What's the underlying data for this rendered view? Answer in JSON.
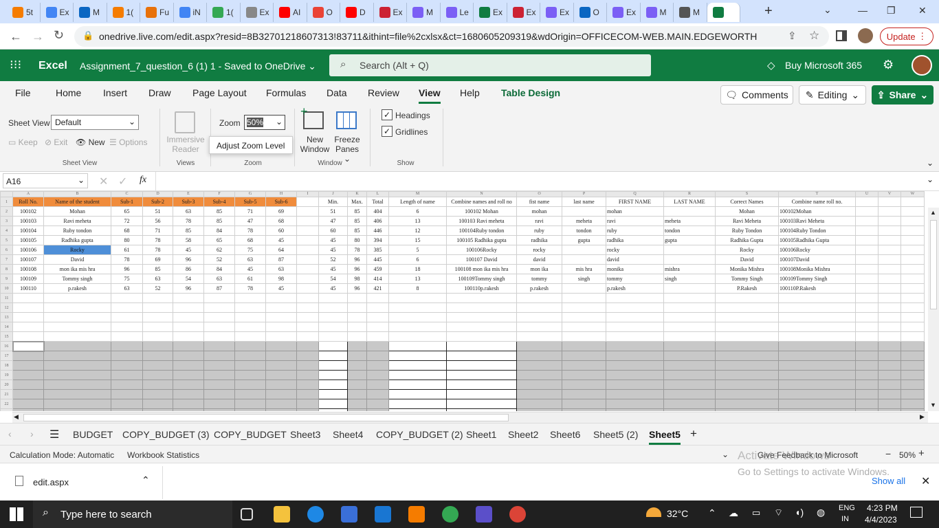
{
  "browser": {
    "tabs": [
      "5t",
      "Ex",
      "M",
      "1(",
      "Fu",
      "iN",
      "1(",
      "Ex",
      "AI",
      "O",
      "D",
      "Ex",
      "M",
      "Le",
      "Ex",
      "Ex",
      "Ex",
      "O",
      "Ex",
      "M",
      "M",
      ""
    ],
    "url": "onedrive.live.com/edit.aspx?resid=8B32701218607313!83711&ithint=file%2cxlsx&ct=1680605209319&wdOrigin=OFFICECOM-WEB.MAIN.EDGEWORTH",
    "update_label": "Update"
  },
  "excel": {
    "app_name": "Excel",
    "doc_title": "Assignment_7_question_6 (1) 1  -  Saved to OneDrive ⌄",
    "search_placeholder": "Search (Alt + Q)",
    "buy_label": "Buy Microsoft 365"
  },
  "ribbon": {
    "tabs": [
      "File",
      "Home",
      "Insert",
      "Draw",
      "Page Layout",
      "Formulas",
      "Data",
      "Review",
      "View",
      "Help",
      "Table Design"
    ],
    "comments": "Comments",
    "editing": "Editing",
    "share": "Share",
    "sheet_view_label": "Sheet View",
    "sheet_view_value": "Default",
    "keep": "Keep",
    "exit": "Exit",
    "new": "New",
    "options": "Options",
    "immersive": "Immersive",
    "reader": "Reader",
    "zoom_label": "Zoom",
    "zoom_value": "50%",
    "tooltip": "Adjust Zoom Level",
    "new_window_1": "New",
    "new_window_2": "Window",
    "freeze_1": "Freeze",
    "freeze_2": "Panes ⌄",
    "headings": "Headings",
    "gridlines": "Gridlines",
    "groups": [
      "Sheet View",
      "Views",
      "Zoom",
      "Window",
      "Show"
    ]
  },
  "formula_bar": {
    "name_box": "A16",
    "fx": "fx",
    "value": ""
  },
  "grid": {
    "columns": [
      "A",
      "B",
      "C",
      "D",
      "E",
      "F",
      "G",
      "H",
      "I",
      "J",
      "K",
      "L",
      "M",
      "N",
      "O",
      "P",
      "Q",
      "R",
      "S",
      "T",
      "U",
      "V",
      "W"
    ],
    "header": [
      "Roll No.",
      "Name of the student",
      "Sub-1",
      "Sub-2",
      "Sub-3",
      "Sub-4",
      "Sub-5",
      "Sub-6",
      "",
      "Min.",
      "Max.",
      "Total",
      "Length of name",
      "Combine names and roll no",
      "fist name",
      "last name",
      "FIRST NAME",
      "LAST NAME",
      "Correct Names",
      "Combine name roll no.",
      "",
      "",
      ""
    ],
    "rows": [
      [
        "100102",
        "Mohan",
        "65",
        "51",
        "63",
        "85",
        "71",
        "69",
        "",
        "51",
        "85",
        "404",
        "6",
        "100102 Mohan",
        "mohan",
        "",
        "mohan",
        "",
        "Mohan",
        "100102Mohan",
        "",
        "",
        ""
      ],
      [
        "100103",
        "Ravi  meheta",
        "72",
        "56",
        "78",
        "85",
        "47",
        "68",
        "",
        "47",
        "85",
        "406",
        "13",
        "100103 Ravi  meheta",
        "ravi",
        "meheta",
        "ravi",
        "meheta",
        "Ravi Meheta",
        "100103Ravi Meheta",
        "",
        "",
        ""
      ],
      [
        "100104",
        "Ruby  tondon",
        "68",
        "71",
        "85",
        "84",
        "78",
        "60",
        "",
        "60",
        "85",
        "446",
        "12",
        "100104Ruby  tondon",
        "ruby",
        "tondon",
        "ruby",
        "tondon",
        "Ruby Tondon",
        "100104Ruby Tondon",
        "",
        "",
        ""
      ],
      [
        "100105",
        "Radhika  gupta",
        "80",
        "78",
        "58",
        "65",
        "68",
        "45",
        "",
        "45",
        "80",
        "394",
        "15",
        "100105 Radhika  gupta",
        "radhika",
        "gupta",
        "radhika",
        "gupta",
        "Radhika Gupta",
        "100105Radhika Gupta",
        "",
        "",
        ""
      ],
      [
        "100106",
        "Rocky",
        "61",
        "78",
        "45",
        "62",
        "75",
        "64",
        "",
        "45",
        "78",
        "385",
        "5",
        "100106Rocky",
        "rocky",
        "",
        "rocky",
        "",
        "Rocky",
        "100106Rocky",
        "",
        "",
        ""
      ],
      [
        "100107",
        "David",
        "78",
        "69",
        "96",
        "52",
        "63",
        "87",
        "",
        "52",
        "96",
        "445",
        "6",
        "100107 David",
        "david",
        "",
        "david",
        "",
        "David",
        "100107David",
        "",
        "",
        ""
      ],
      [
        "100108",
        "mon ika   mis hra",
        "96",
        "85",
        "86",
        "84",
        "45",
        "63",
        "",
        "45",
        "96",
        "459",
        "18",
        "100108 mon ika   mis hra",
        "mon ika",
        "mis hra",
        "monika",
        "mishra",
        "Monika Mishra",
        "100108Monika Mishra",
        "",
        "",
        ""
      ],
      [
        "100109",
        "Tommy   singh",
        "75",
        "63",
        "54",
        "63",
        "61",
        "98",
        "",
        "54",
        "98",
        "414",
        "13",
        "100109Tommy   singh",
        "tommy",
        "singh",
        "tommy",
        "singh",
        "Tommy Singh",
        "100109Tommy Singh",
        "",
        "",
        ""
      ],
      [
        "100110",
        "p.rakesh",
        "63",
        "52",
        "96",
        "87",
        "78",
        "45",
        "",
        "45",
        "96",
        "421",
        "8",
        "100110p.rakesh",
        "p.rakesh",
        "",
        "p.rakesh",
        "",
        "P.Rakesh",
        "100110P.Rakesh",
        "",
        "",
        ""
      ]
    ]
  },
  "sheets": [
    "BUDGET",
    "COPY_BUDGET (3)",
    "COPY_BUDGET",
    "Sheet3",
    "Sheet4",
    "COPY_BUDGET (2)",
    "Sheet1",
    "Sheet2",
    "Sheet6",
    "Sheet5 (2)",
    "Sheet5"
  ],
  "active_sheet": "Sheet5",
  "status": {
    "calc_mode": "Calculation Mode: Automatic",
    "workbook_stats": "Workbook Statistics",
    "feedback": "Give Feedback to Microsoft",
    "zoom": "50%",
    "activate_1": "Activate Windows",
    "activate_2": "Go to Settings to activate Windows."
  },
  "download": {
    "file": "edit.aspx",
    "show_all": "Show all"
  },
  "taskbar": {
    "search": "Type here to search",
    "temp": "32°C",
    "lang1": "ENG",
    "lang2": "IN",
    "time": "4:23 PM",
    "date": "4/4/2023"
  },
  "colors": {
    "excel_green": "#107c41",
    "header_orange": "#f08c3c",
    "select_blue": "#4e8fd8"
  }
}
